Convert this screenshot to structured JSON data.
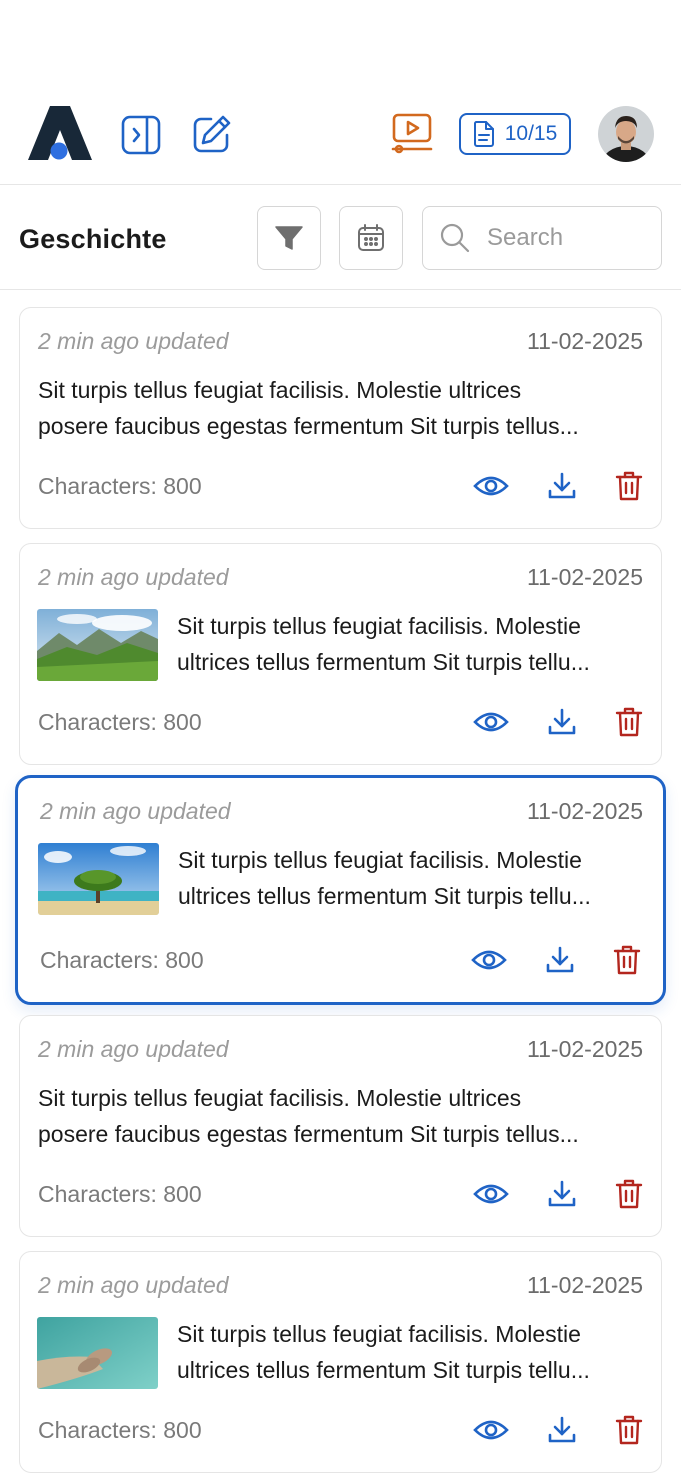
{
  "header": {
    "quota_text": "10/15",
    "icons": [
      "app-logo",
      "sidebar-toggle-icon",
      "edit-icon",
      "video-icon",
      "document-icon",
      "avatar"
    ]
  },
  "toolbar": {
    "title": "Geschichte",
    "search_placeholder": "Search"
  },
  "cards": [
    {
      "updated": "2 min ago updated",
      "date": "11-02-2025",
      "line1": "Sit turpis tellus feugiat facilisis. Molestie ultrices",
      "line2": "posere faucibus egestas fermentum Sit turpis tellus...",
      "characters": "Characters: 800",
      "thumbnail": "none"
    },
    {
      "updated": "2 min ago updated",
      "date": "11-02-2025",
      "line1": "Sit turpis tellus feugiat facilisis. Molestie",
      "line2": "ultrices tellus fermentum Sit turpis tellu...",
      "characters": "Characters: 800",
      "thumbnail": "mountain-landscape"
    },
    {
      "updated": "2 min ago updated",
      "date": "11-02-2025",
      "line1": "Sit turpis tellus feugiat facilisis. Molestie",
      "line2": "ultrices tellus fermentum Sit turpis tellu...",
      "characters": "Characters: 800",
      "thumbnail": "tree-beach",
      "selected": true
    },
    {
      "updated": "2 min ago updated",
      "date": "11-02-2025",
      "line1": "Sit turpis tellus feugiat facilisis. Molestie ultrices",
      "line2": "posere faucibus egestas fermentum Sit turpis tellus...",
      "characters": "Characters: 800",
      "thumbnail": "none"
    },
    {
      "updated": "2 min ago updated",
      "date": "11-02-2025",
      "line1": "Sit turpis tellus feugiat facilisis. Molestie",
      "line2": "ultrices tellus fermentum Sit turpis tellu...",
      "characters": "Characters: 800",
      "thumbnail": "feet-water"
    }
  ],
  "colors": {
    "accent": "#1f63c6",
    "video_orange": "#d2691e",
    "delete_red": "#b3261e",
    "logo_dark": "#182838"
  }
}
